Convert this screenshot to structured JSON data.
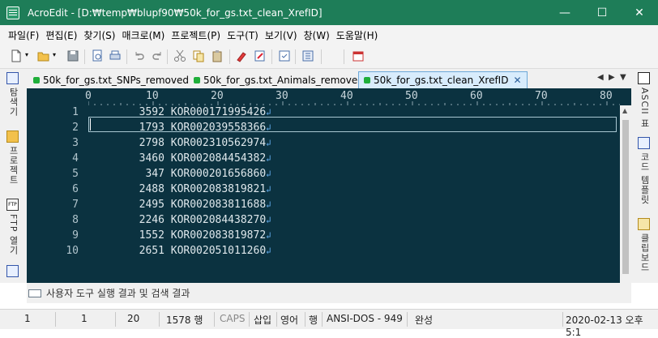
{
  "window": {
    "title": "AcroEdit - [D:₩temp₩blupf90₩50k_for_gs.txt_clean_XrefID]",
    "minimize": "—",
    "maximize": "☐",
    "close": "✕"
  },
  "menu": {
    "items": [
      "파일(F)",
      "편집(E)",
      "찾기(S)",
      "매크로(M)",
      "프로젝트(P)",
      "도구(T)",
      "보기(V)",
      "창(W)",
      "도움말(H)"
    ]
  },
  "toolbar": {
    "icons": [
      "new-file-icon",
      "open-folder-icon",
      "save-icon",
      "print-preview-icon",
      "print-icon",
      "undo-icon",
      "redo-icon",
      "cut-icon",
      "copy-icon",
      "paste-icon",
      "marker-icon",
      "edit-icon",
      "properties-icon",
      "list-icon",
      "calendar-icon"
    ]
  },
  "left_panel": {
    "tabs": [
      {
        "label": "탐색기",
        "icon": "explorer-icon"
      },
      {
        "label": "프로젝트",
        "icon": "project-icon"
      },
      {
        "label": "FTP 열기",
        "icon": "ftp-icon"
      }
    ]
  },
  "right_panel": {
    "tabs": [
      {
        "label": "ASCII 표",
        "icon": "ascii-table-icon"
      },
      {
        "label": "코드 템플릿",
        "icon": "code-template-icon"
      },
      {
        "label": "클립보드",
        "icon": "clipboard-icon"
      }
    ]
  },
  "tabs": [
    {
      "label": "50k_for_gs.txt_SNPs_removed",
      "active": false
    },
    {
      "label": "50k_for_gs.txt_Animals_removed",
      "active": false
    },
    {
      "label": "50k_for_gs.txt_clean_XrefID",
      "active": true,
      "close": "✕"
    }
  ],
  "tab_nav": {
    "prev": "◀",
    "next": "▶",
    "list": "▼"
  },
  "ruler": {
    "marks": [
      "0",
      "10",
      "20",
      "30",
      "40",
      "50",
      "60",
      "70",
      "80"
    ]
  },
  "editor": {
    "eol_symbol": "↲",
    "lines": [
      {
        "num": "1",
        "text": "        3592 KOR000171995426"
      },
      {
        "num": "2",
        "text": "        1793 KOR002039558366"
      },
      {
        "num": "3",
        "text": "        2798 KOR002310562974"
      },
      {
        "num": "4",
        "text": "        3460 KOR002084454382"
      },
      {
        "num": "5",
        "text": "         347 KOR000201656860"
      },
      {
        "num": "6",
        "text": "        2488 KOR002083819821"
      },
      {
        "num": "7",
        "text": "        2495 KOR002083811688"
      },
      {
        "num": "8",
        "text": "        2246 KOR002084438270"
      },
      {
        "num": "9",
        "text": "        1552 KOR002083819872"
      },
      {
        "num": "10",
        "text": "        2651 KOR002051011260"
      }
    ]
  },
  "output_panel": {
    "label": "사용자 도구 실행 결과 및 검색 결과"
  },
  "status": {
    "line": "1",
    "col": "1",
    "chars": "20",
    "total": "1578 행",
    "caps": "CAPS",
    "insert": "삽입",
    "lang": "영어",
    "mode": "행",
    "encoding": "ANSI-DOS - 949",
    "state": "완성",
    "datetime": "2020-02-13 오후 5:1"
  },
  "colors": {
    "titlebar": "#1e7d58",
    "editor_bg": "#0b3240",
    "eol": "#5fa8e8",
    "tab_active": "#d8ecfc"
  }
}
